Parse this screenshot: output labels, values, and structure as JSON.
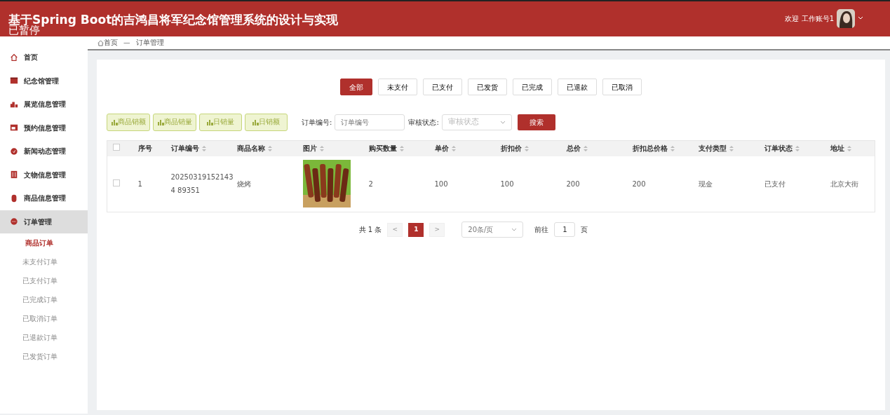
{
  "header": {
    "title": "基于Spring Boot的吉鸿昌将军纪念馆管理系统的设计与实现",
    "overlay_text": "已暂停",
    "welcome": "欢迎 工作账号1"
  },
  "sidebar": {
    "items": [
      {
        "label": "首页",
        "selected": false
      },
      {
        "label": "纪念馆管理",
        "selected": false
      },
      {
        "label": "展览信息管理",
        "selected": false
      },
      {
        "label": "预约信息管理",
        "selected": false
      },
      {
        "label": "新闻动态管理",
        "selected": false
      },
      {
        "label": "文物信息管理",
        "selected": false
      },
      {
        "label": "商品信息管理",
        "selected": false
      },
      {
        "label": "订单管理",
        "selected": true,
        "children": [
          {
            "label": "商品订单",
            "selected": true
          },
          {
            "label": "未支付订单",
            "selected": false
          },
          {
            "label": "已支付订单",
            "selected": false
          },
          {
            "label": "已完成订单",
            "selected": false
          },
          {
            "label": "已取消订单",
            "selected": false
          },
          {
            "label": "已退款订单",
            "selected": false
          },
          {
            "label": "已发货订单",
            "selected": false
          }
        ]
      }
    ]
  },
  "breadcrumb": [
    "首页",
    "订单管理"
  ],
  "breadcrumb_separator": "—",
  "status_tabs": [
    {
      "label": "全部",
      "selected": true
    },
    {
      "label": "未支付",
      "selected": false
    },
    {
      "label": "已支付",
      "selected": false
    },
    {
      "label": "已发货",
      "selected": false
    },
    {
      "label": "已完成",
      "selected": false
    },
    {
      "label": "已退款",
      "selected": false
    },
    {
      "label": "已取消",
      "selected": false
    }
  ],
  "chart_buttons": [
    "商品销额",
    "商品销量",
    "日销量",
    "日销额"
  ],
  "filters": [
    {
      "kind": "input",
      "label": "订单编号:",
      "placeholder": "订单编号"
    },
    {
      "kind": "select",
      "label": "审核状态:",
      "placeholder": "审核状态"
    }
  ],
  "search_button": "搜索",
  "table": {
    "all_checked": false,
    "columns": [
      "序号",
      "订单编号",
      "商品名称",
      "图片",
      "购买数量",
      "单价",
      "折扣价",
      "总价",
      "折扣总价格",
      "支付类型",
      "订单状态",
      "地址"
    ],
    "rows": [
      {
        "checked": false,
        "cells": [
          "1",
          "202503191521434 89351",
          "烧烤",
          {
            "kind": "picture"
          },
          "2",
          "100",
          "100",
          "200",
          "200",
          "现金",
          "已支付",
          "北京大街"
        ]
      }
    ]
  },
  "pagination": {
    "total": "共 1 条",
    "prev": "<",
    "pages": [
      {
        "label": "1",
        "selected": true
      }
    ],
    "next": ">",
    "page_size": "20条/页",
    "goto": "前往",
    "goto_value": "1",
    "page_unit": "页"
  }
}
